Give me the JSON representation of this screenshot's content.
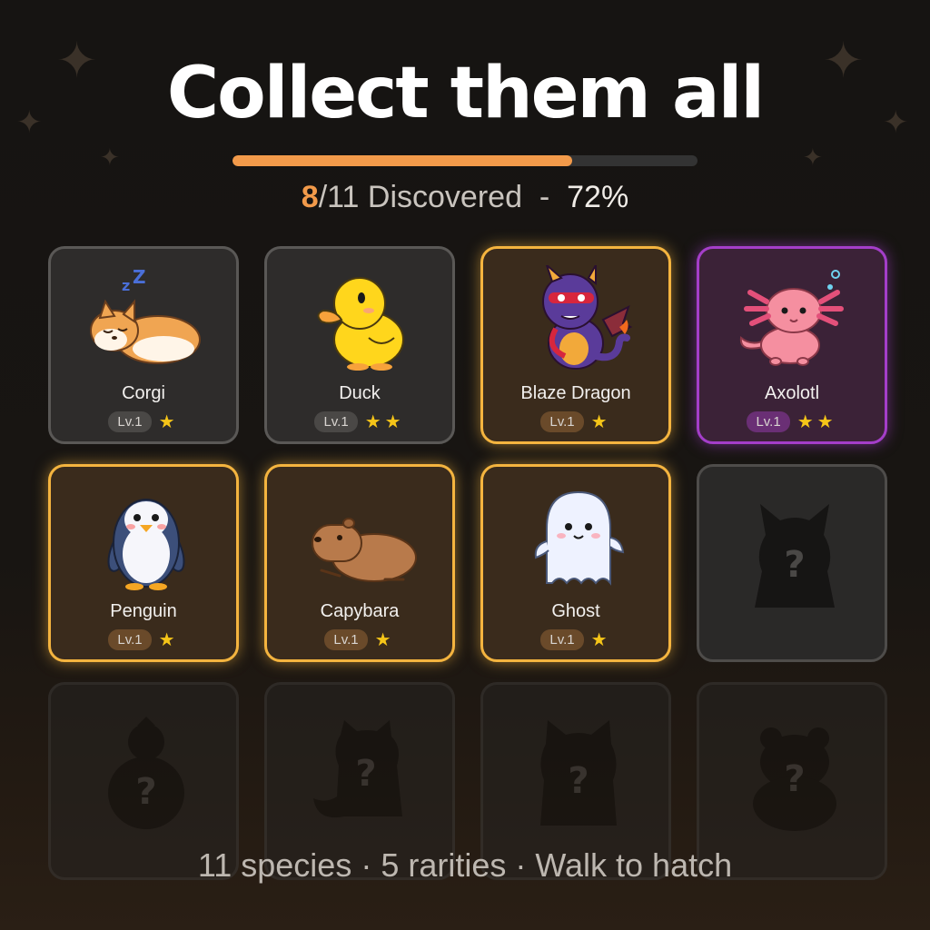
{
  "header": {
    "title": "Collect them all"
  },
  "progress": {
    "found": "8",
    "total_text": "/11 Discovered",
    "separator": "-",
    "percent_text": "72%",
    "fill_fraction": 0.73
  },
  "cards": [
    {
      "name": "Corgi",
      "level": "Lv.1",
      "stars": "★",
      "rarity": "common",
      "icon": "corgi-icon"
    },
    {
      "name": "Duck",
      "level": "Lv.1",
      "stars": "★★",
      "rarity": "common",
      "icon": "duck-icon"
    },
    {
      "name": "Blaze Dragon",
      "level": "Lv.1",
      "stars": "★",
      "rarity": "gold",
      "icon": "dragon-icon"
    },
    {
      "name": "Axolotl",
      "level": "Lv.1",
      "stars": "★★",
      "rarity": "purple",
      "icon": "axolotl-icon"
    },
    {
      "name": "Penguin",
      "level": "Lv.1",
      "stars": "★",
      "rarity": "gold",
      "icon": "penguin-icon"
    },
    {
      "name": "Capybara",
      "level": "Lv.1",
      "stars": "★",
      "rarity": "gold",
      "icon": "capybara-icon"
    },
    {
      "name": "Ghost",
      "level": "Lv.1",
      "stars": "★",
      "rarity": "gold",
      "icon": "ghost-icon"
    }
  ],
  "locked_mark": "?",
  "footer": {
    "text": "11 species · 5 rarities · Walk to hatch"
  },
  "colors": {
    "accent": "#f29a4a",
    "gold": "#f4b43f",
    "purple": "#a43ec9",
    "star": "#f5c518"
  }
}
